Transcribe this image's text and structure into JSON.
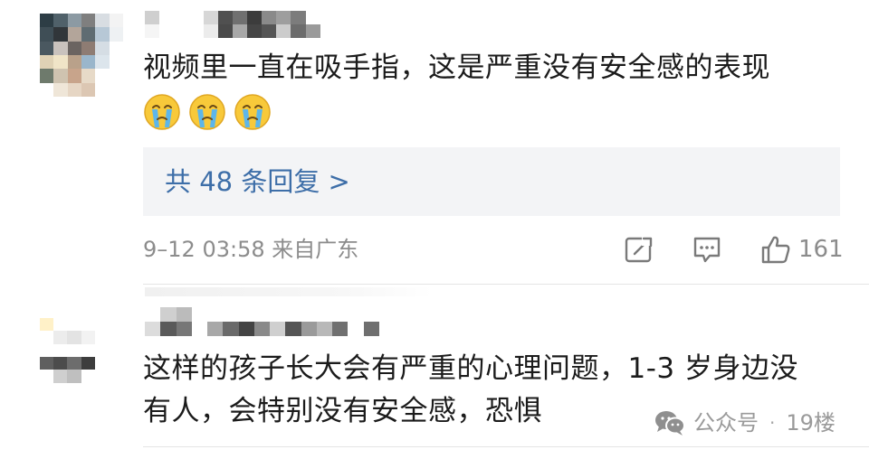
{
  "comments": [
    {
      "text": "视频里一直在吸手指，这是严重没有安全感的表现",
      "emojis": [
        "crying-face",
        "crying-face",
        "crying-face"
      ],
      "replies_label": "共 48 条回复 >",
      "timestamp": "9–12 03:58 来自广东",
      "likes": "161",
      "avatar_colors": [
        "#2d3d45",
        "#50616a",
        "#8c9aa3",
        "#7f7f7f",
        "#d8dde2",
        "#f3f3f3",
        "#3f4e56",
        "#31363a",
        "#b3a59a",
        "#5f6c72",
        "#b7c8d6",
        "#eef1f3",
        "#4a5860",
        "#c9c2bd",
        "#6b6461",
        "#8e7c73",
        "#d5dde4",
        "#ffffff",
        "#e0d2b5",
        "#f0e4c7",
        "#b9a18a",
        "#9ab6cb",
        "#dce5ec",
        "#ffffff",
        "#6e7a6c",
        "#cfc3b0",
        "#c8a48b",
        "#e7dac8",
        "#ffffff",
        "#ffffff",
        "#ffffff",
        "#efe6d8",
        "#e6d6c4",
        "#dcc7b3",
        "#ffffff",
        "#ffffff"
      ],
      "name_colors": [
        "#cfcfcf",
        "#ffffff",
        "#ffffff",
        "#ffffff",
        "#d7d7d7",
        "#505050",
        "#707070",
        "#3c3c3c",
        "#8a8a8a",
        "#9e9e9e",
        "#7c7c7c",
        "#ffffff",
        "#ffffff",
        "#ffffff",
        "#f5f5f5",
        "#ffffff",
        "#ffffff",
        "#ffffff",
        "#ececec",
        "#4a4a4a",
        "#a8a8a8",
        "#454545",
        "#555555",
        "#cccccc",
        "#6c6c6c",
        "#9a9a9a",
        "#ffffff",
        "#ffffff"
      ]
    },
    {
      "text_lines": [
        "这样的孩子长大会有严重的心理问题，1-3 岁身边没",
        "有人，会特别没有安全感，恐惧"
      ],
      "avatar_colors": [
        "#fff1c8",
        "#ffffff",
        "#ffffff",
        "#ffffff",
        "#ffffff",
        "#ffffff",
        "#ececec",
        "#e3e3e3",
        "#f2f2f2",
        "#ffffff",
        "#ffffff",
        "#ffffff",
        "#ffffff",
        "#ffffff",
        "#ffffff",
        "#5f5f5f",
        "#4c4c4c",
        "#6d6d6d",
        "#3d3d3d",
        "#ffffff",
        "#ffffff",
        "#cfcfcf",
        "#bfbfbf",
        "#ffffff",
        "#ffffff",
        "#ffffff",
        "#ffffff",
        "#ffffff",
        "#ffffff",
        "#ffffff"
      ],
      "name_colors": [
        "#ffffff",
        "#cfcfcf",
        "#bbbbbb",
        "#ffffff",
        "#ffffff",
        "#ffffff",
        "#ffffff",
        "#ffffff",
        "#ffffff",
        "#ffffff",
        "#ffffff",
        "#ffffff",
        "#ffffff",
        "#ffffff",
        "#ffffff",
        "#ffffff",
        "#dcdcdc",
        "#5a5a5a",
        "#777777",
        "#ffffff",
        "#a8a8a8",
        "#6a6a6a",
        "#444444",
        "#8a8a8a",
        "#cfcfcf",
        "#555555",
        "#9a9a9a",
        "#b8b8b8",
        "#707070",
        "#ffffff",
        "#6f6f6f",
        "#ffffff"
      ]
    }
  ],
  "watermark": {
    "label": "公众号",
    "separator": "·",
    "floor": "19楼"
  },
  "colors": {
    "link": "#3d6ea8",
    "meta": "#8c8c8c",
    "reply_bg": "#f3f4f6"
  }
}
